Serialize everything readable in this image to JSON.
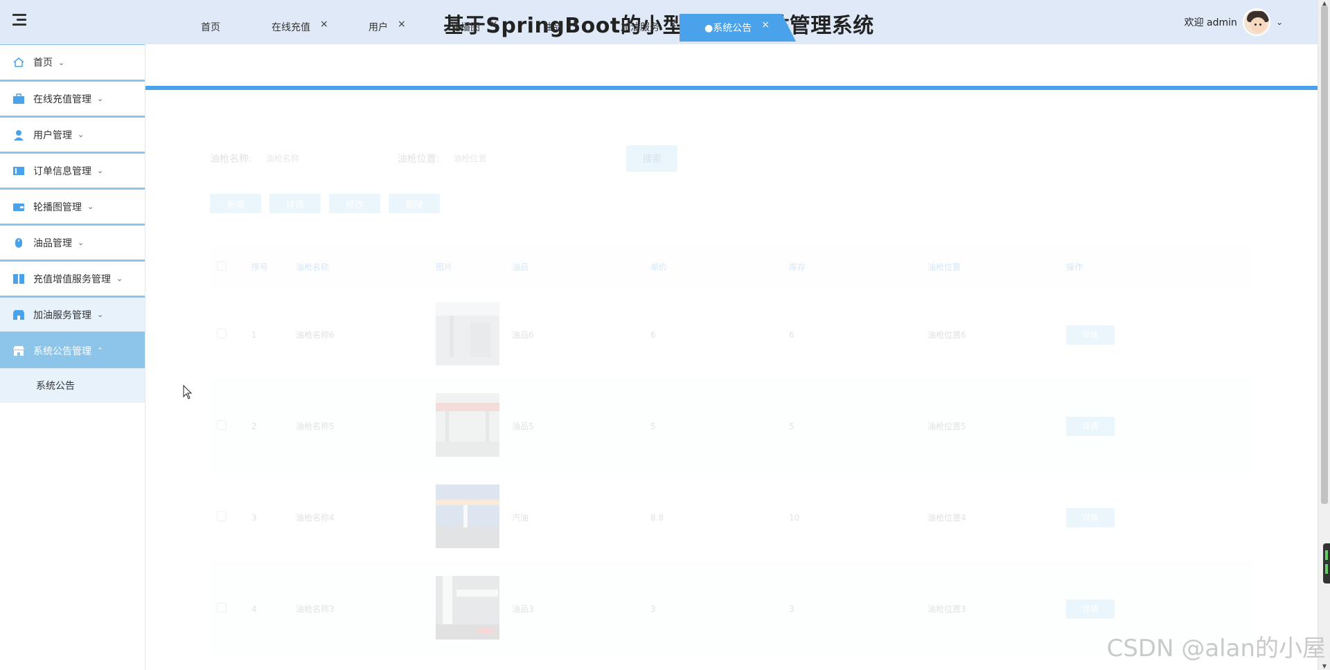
{
  "header": {
    "title": "基于SpringBoot的小型民营加油站管理系统",
    "welcome": "欢迎 admin"
  },
  "sidebar": {
    "items": [
      {
        "label": "首页",
        "icon": "home-icon"
      },
      {
        "label": "在线充值管理",
        "icon": "briefcase-icon"
      },
      {
        "label": "用户管理",
        "icon": "user-icon"
      },
      {
        "label": "订单信息管理",
        "icon": "order-icon"
      },
      {
        "label": "轮播图管理",
        "icon": "wallet-icon"
      },
      {
        "label": "油品管理",
        "icon": "mouse-icon"
      },
      {
        "label": "充值增值服务管理",
        "icon": "columns-icon"
      },
      {
        "label": "加油服务管理",
        "icon": "shop-icon"
      },
      {
        "label": "系统公告管理",
        "icon": "store-icon"
      }
    ],
    "sub_item": "系统公告"
  },
  "tabs": [
    {
      "label": "首页"
    },
    {
      "label": "在线充值",
      "close": "×"
    },
    {
      "label": "用户",
      "close": "×"
    },
    {
      "label": "轮播图",
      "close": "×"
    },
    {
      "label": "油品",
      "close": "×"
    },
    {
      "label": "加油服务",
      "close": "×"
    },
    {
      "label": "●系统公告",
      "close": "×"
    }
  ],
  "search": {
    "label1": "油枪名称:",
    "placeholder1": "油枪名称",
    "label2": "油枪位置:",
    "placeholder2": "油枪位置",
    "button": "搜索"
  },
  "actions": {
    "add": "新增",
    "detail": "详情",
    "edit": "修改",
    "delete": "删除"
  },
  "table": {
    "headers": {
      "index": "序号",
      "name": "油枪名称",
      "image": "图片",
      "oil": "油品",
      "price": "单价",
      "stock": "库存",
      "location": "油枪位置",
      "op": "操作"
    },
    "rows": [
      {
        "index": "1",
        "name": "油枪名称6",
        "oil": "油品6",
        "price": "6",
        "stock": "6",
        "location": "油枪位置6",
        "op": "详情"
      },
      {
        "index": "2",
        "name": "油枪名称5",
        "oil": "油品5",
        "price": "5",
        "stock": "5",
        "location": "油枪位置5",
        "op": "详情"
      },
      {
        "index": "3",
        "name": "油枪名称4",
        "oil": "汽油",
        "price": "8.8",
        "stock": "10",
        "location": "油枪位置4",
        "op": "详情"
      },
      {
        "index": "4",
        "name": "油枪名称3",
        "oil": "油品3",
        "price": "3",
        "stock": "3",
        "location": "油枪位置3",
        "op": "详情"
      }
    ]
  },
  "watermark": "CSDN @alan的小屋",
  "colors": {
    "header_bg": "#dfe9f7",
    "accent": "#4aa3ea",
    "menu_active": "#8cc4ea"
  }
}
